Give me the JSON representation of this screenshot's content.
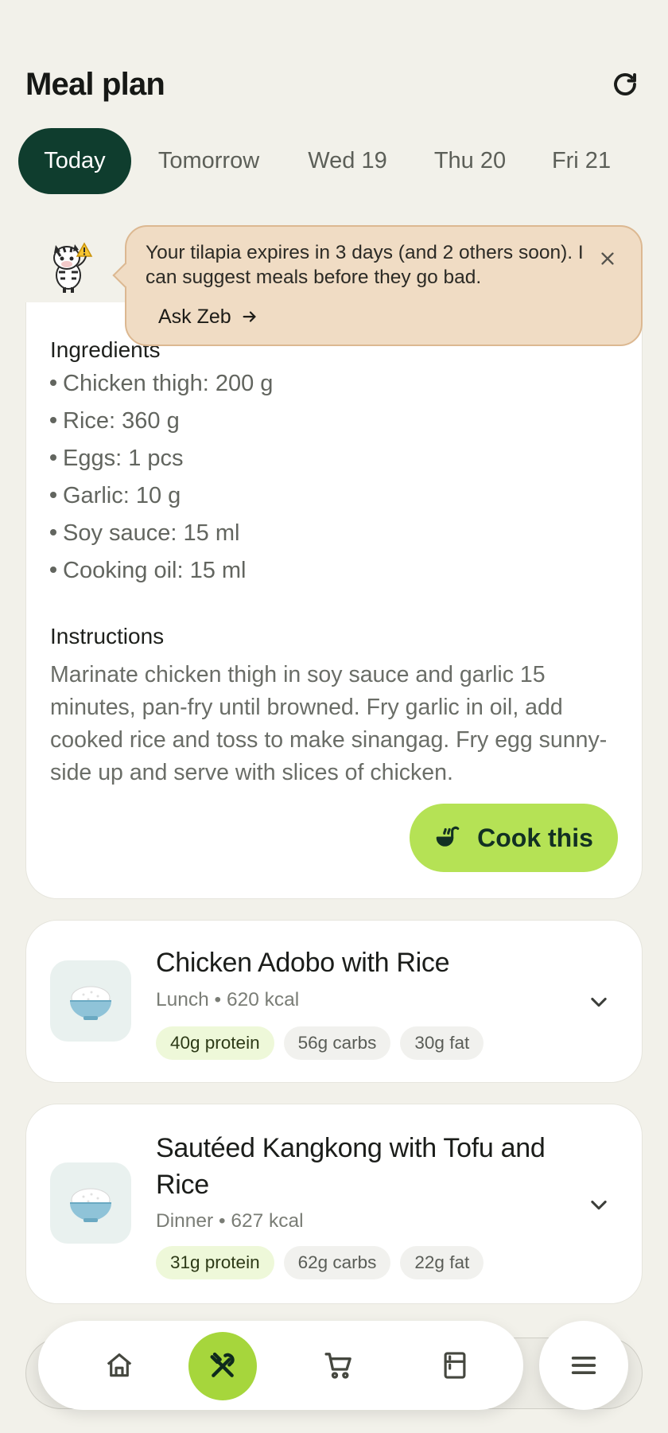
{
  "header": {
    "title": "Meal plan",
    "refresh_icon": "refresh-icon"
  },
  "day_tabs": [
    {
      "label": "Today",
      "active": true
    },
    {
      "label": "Tomorrow",
      "active": false
    },
    {
      "label": "Wed 19",
      "active": false
    },
    {
      "label": "Thu 20",
      "active": false
    },
    {
      "label": "Fri 21",
      "active": false
    }
  ],
  "alert": {
    "avatar_icon": "zebra-mascot-warning-icon",
    "message": "Your tilapia expires in 3 days (and 2 others soon). I can suggest meals before they go bad.",
    "action_label": "Ask Zeb",
    "action_icon": "arrow-right-icon",
    "close_icon": "close-icon"
  },
  "recipe": {
    "ingredients_heading": "Ingredients",
    "ingredients": [
      "Chicken thigh: 200 g",
      "Rice: 360 g",
      "Eggs: 1 pcs",
      "Garlic: 10 g",
      "Soy sauce: 15 ml",
      "Cooking oil: 15 ml"
    ],
    "instructions_heading": "Instructions",
    "instructions": "Marinate chicken thigh in soy sauce and garlic 15 minutes, pan-fry until browned. Fry garlic in oil, add cooked rice and toss to make sinangag. Fry egg sunny-side up and serve with slices of chicken.",
    "cook_button": "Cook this",
    "cook_icon": "ladle-icon"
  },
  "meals": [
    {
      "title": "Chicken Adobo with Rice",
      "meta": "Lunch • 620 kcal",
      "thumb_icon": "rice-bowl-icon",
      "macros": {
        "protein": "40g protein",
        "carbs": "56g carbs",
        "fat": "30g fat"
      }
    },
    {
      "title": "Sautéed Kangkong with Tofu and Rice",
      "meta": "Dinner • 627 kcal",
      "thumb_icon": "rice-bowl-icon",
      "macros": {
        "protein": "31g protein",
        "carbs": "62g carbs",
        "fat": "22g fat"
      }
    }
  ],
  "nav": {
    "items": [
      "home-icon",
      "fork-knife-icon",
      "cart-icon",
      "pantry-icon"
    ],
    "active": "fork-knife-icon",
    "menu_icon": "menu-icon"
  },
  "colors": {
    "background": "#f2f1ea",
    "active_tab": "#0f3d2e",
    "accent_green": "#b5e255",
    "alert_bg": "#f0dcc4",
    "protein_chip": "#eef8d9"
  }
}
